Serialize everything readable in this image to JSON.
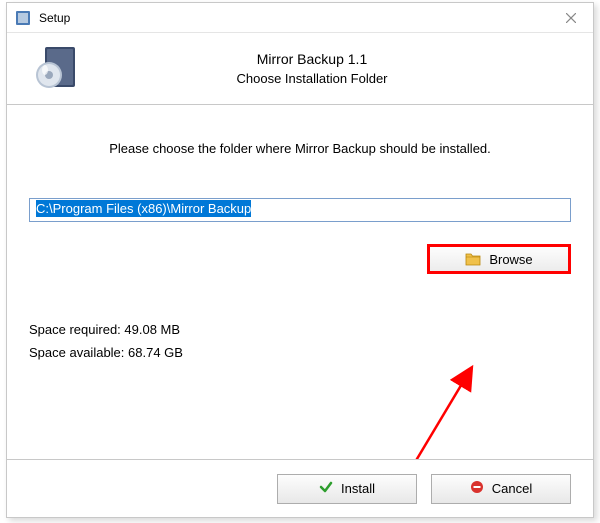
{
  "titlebar": {
    "title": "Setup"
  },
  "header": {
    "product": "Mirror Backup 1.1",
    "subtitle": "Choose Installation Folder"
  },
  "body": {
    "instruction": "Please choose the folder where Mirror Backup should be installed.",
    "path_value": "C:\\Program Files (x86)\\Mirror Backup",
    "browse_label": "Browse",
    "space_required_label": "Space required: 49.08 MB",
    "space_available_label": "Space available: 68.74 GB"
  },
  "footer": {
    "install_label": "Install",
    "cancel_label": "Cancel"
  }
}
